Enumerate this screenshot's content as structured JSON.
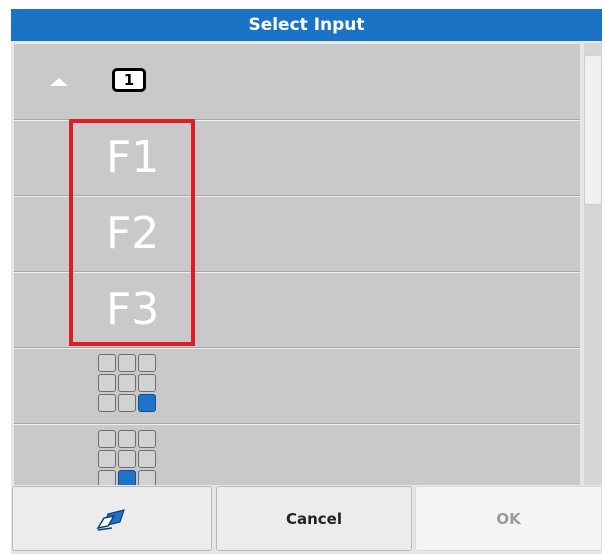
{
  "dialog": {
    "title": "Select Input"
  },
  "list": {
    "page_number": "1",
    "items": [
      {
        "label": "F1"
      },
      {
        "label": "F2"
      },
      {
        "label": "F3"
      }
    ],
    "grid_items": [
      {
        "active_cell": 8
      },
      {
        "active_cell": 7
      }
    ]
  },
  "footer": {
    "erase_icon": "eraser-icon",
    "cancel_label": "Cancel",
    "ok_label": "OK"
  },
  "colors": {
    "title_bar": "#1a73c4",
    "highlight": "#dd1d24",
    "active_cell": "#1d74c8"
  }
}
